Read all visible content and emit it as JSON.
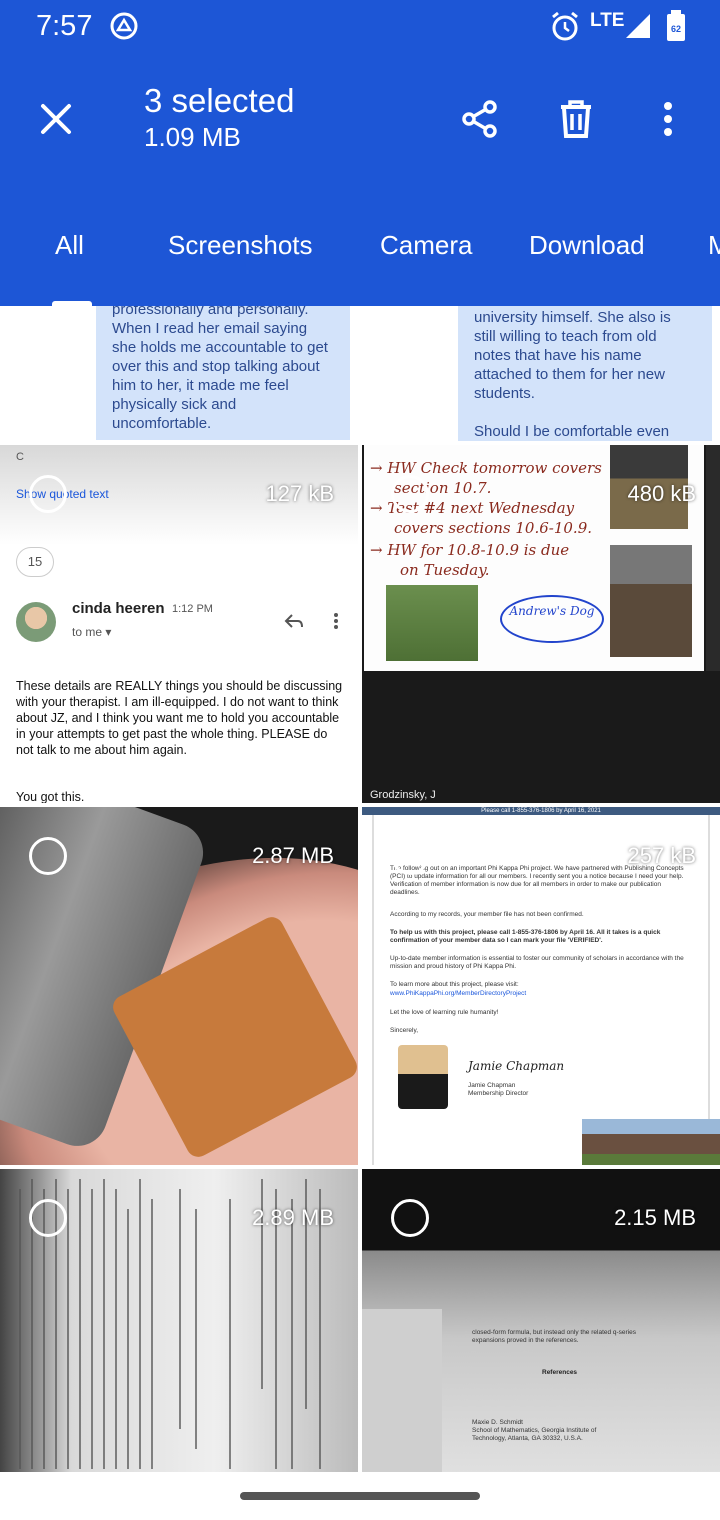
{
  "status_bar": {
    "time": "7:57",
    "network": "LTE"
  },
  "selection": {
    "title": "3 selected",
    "size": "1.09 MB"
  },
  "tabs": [
    "All",
    "Screenshots",
    "Camera",
    "Download",
    "M"
  ],
  "grid": {
    "top_left_snippet": "professionally and personally. When I read her email saying she holds me accountable to get over this and stop talking about him to her, it made me feel physically sick and uncomfortable.",
    "top_right_snippet": "university himself. She also is still willing to teach from old notes that have his name attached to them for her new students.\n\nShould I be comfortable even",
    "items": [
      {
        "size": "127 kB",
        "type": "email-screenshot"
      },
      {
        "size": "480 kB",
        "type": "whiteboard-screenshot"
      },
      {
        "size": "2.87 MB",
        "type": "photo"
      },
      {
        "size": "257 kB",
        "type": "letter-screenshot"
      },
      {
        "size": "2.89 MB",
        "type": "photo-book-page"
      },
      {
        "size": "2.15 MB",
        "type": "photo-book-page"
      }
    ]
  },
  "email": {
    "header_letter": "C",
    "show_quoted": "Show quoted text",
    "thread_count": "15",
    "sender": "cinda heeren",
    "time": "1:12 PM",
    "to": "to me",
    "body": "These details are REALLY things you should be discussing with your therapist. I am ill-equipped. I do not want to think about JZ, and I think you want me to hold you accountable in your attempts to get past the whole thing.  PLEASE do not talk to me about him again.",
    "sign": "You got this."
  },
  "whiteboard": {
    "lines": [
      "→ HW Check tomorrow covers",
      "section 10.7.",
      "→ Test #4 next Wednesday",
      "covers sections 10.6-10.9.",
      "→ HW for 10.8-10.9 is due",
      "on Tuesday."
    ],
    "bubble": "Andrew's Dog",
    "participant": "Grodzinsky, J"
  },
  "letter": {
    "header": "Please call 1-855-376-1806 by April 16, 2021",
    "p1": "The following out on an important Phi Kappa Phi project. We have partnered with Publishing Concepts (PCI) to update information for all our members. I recently sent you a notice because I need your help. Verification of member information is now due for all members in order to make our publication deadlines.",
    "p2": "According to my records, your member file has not been confirmed.",
    "p3": "To help us with this project, please call 1-855-376-1806 by April 16. All it takes is a quick confirmation of your member data so I can mark your file 'VERIFIED'.",
    "p4": "Up-to-date member information is essential to foster our community of scholars in accordance with the mission and proud history of Phi Kappa Phi.",
    "p5": "To learn more about this project, please visit:",
    "link": "www.PhiKappaPhi.org/MemberDirectoryProject",
    "p6": "Let the love of learning rule humanity!",
    "p7": "Sincerely,",
    "signature": "Jamie Chapman",
    "name": "Jamie Chapman",
    "role": "Membership Director"
  },
  "book_right": {
    "heading": "References",
    "line1": "closed-form formula, but instead only the related q-series expansions proved in the references.",
    "author": "Maxie D. Schmidt",
    "affil": "School of Mathematics, Georgia Institute of Technology, Atlanta, GA 30332, U.S.A."
  }
}
